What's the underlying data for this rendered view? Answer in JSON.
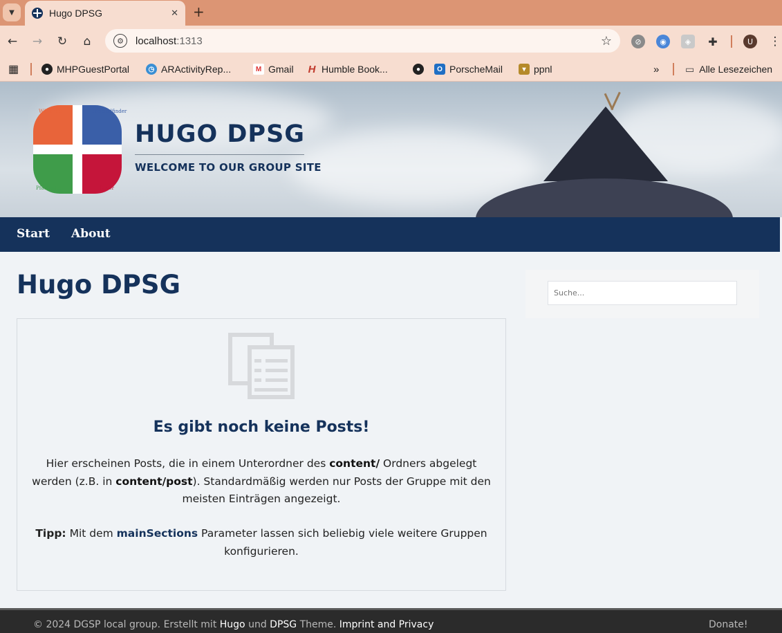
{
  "browser": {
    "tab_title": "Hugo DPSG",
    "url_host": "localhost",
    "url_port": ":1313",
    "bookmarks": [
      {
        "label": "MHPGuestPortal"
      },
      {
        "label": "ARActivityRep..."
      },
      {
        "label": "Gmail"
      },
      {
        "label": "Humble Book..."
      },
      {
        "label": ""
      },
      {
        "label": "PorscheMail"
      },
      {
        "label": "ppnl"
      }
    ],
    "all_bookmarks_label": "Alle Lesezeichen",
    "profile_initial": "U"
  },
  "site": {
    "title": "HUGO DPSG",
    "subtitle": "WELCOME TO OUR GROUP SITE",
    "logo_labels": {
      "q1": "Wölflinge",
      "q2": "Jungpfadfinder",
      "q3": "Pfadfinder",
      "q4": "Rover"
    }
  },
  "nav": {
    "items": [
      {
        "label": "Start"
      },
      {
        "label": "About"
      }
    ]
  },
  "main": {
    "page_title": "Hugo DPSG",
    "empty": {
      "title": "Es gibt noch keine Posts!",
      "t1": "Hier erscheinen Posts, die in einem Unterordner des ",
      "b1": "content/",
      "t2": " Ordners abgelegt werden (z.B. in ",
      "b2": "content/post",
      "t3": "). Standardmäßig werden nur Posts der Gruppe mit den meisten Einträgen angezeigt.",
      "tip_label": "Tipp:",
      "tip_t1": " Mit dem ",
      "tip_hl": "mainSections",
      "tip_t2": " Parameter lassen sich beliebig viele weitere Gruppen konfigurieren."
    }
  },
  "sidebar": {
    "search_placeholder": "Suche..."
  },
  "footer": {
    "t1": "© 2024 DGSP local group. Erstellt mit ",
    "hugo": "Hugo",
    "t2": " und ",
    "dpsg": "DPSG",
    "t3": " Theme. ",
    "imprint": "Imprint and Privacy",
    "donate": "Donate!"
  },
  "colors": {
    "primary": "#15325b",
    "tabstrip": "#dc9574",
    "chrome": "#f7ddd0",
    "footer": "#2b2b2b"
  }
}
